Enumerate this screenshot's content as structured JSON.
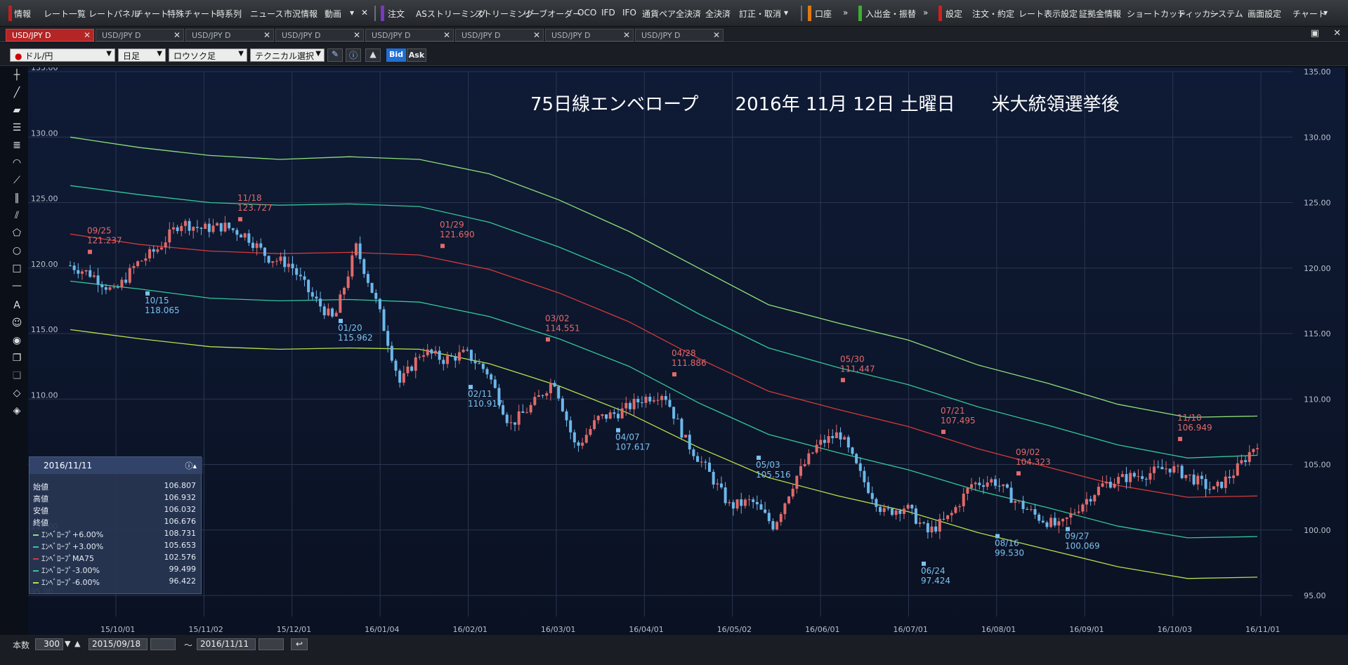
{
  "menu": {
    "items": [
      "情報",
      "レート一覧",
      "レートパネル",
      "チャート",
      "特殊チャート",
      "時系列",
      "ニュース",
      "市況情報",
      "動画",
      "注文",
      "ASストリーミング",
      "ストリーミング",
      "リーブオーダー",
      "OCO",
      "IFD",
      "IFO",
      "通貨ペア全決済",
      "全決済",
      "訂正・取消",
      "口座",
      "入出金・振替",
      "設定",
      "注文・約定",
      "レート表示設定",
      "証拠金情報",
      "ショートカット",
      "ティッカー",
      "システム",
      "画面設定",
      "チャート"
    ]
  },
  "tabs": [
    {
      "label": "USD/JPY D",
      "active": true
    },
    {
      "label": "USD/JPY D",
      "active": false
    },
    {
      "label": "USD/JPY D",
      "active": false
    },
    {
      "label": "USD/JPY D",
      "active": false
    },
    {
      "label": "USD/JPY D",
      "active": false
    },
    {
      "label": "USD/JPY D",
      "active": false
    },
    {
      "label": "USD/JPY D",
      "active": false
    },
    {
      "label": "USD/JPY D",
      "active": false
    }
  ],
  "toolbar": {
    "pair": "ドル/円",
    "period": "日足",
    "chart_type": "ロウソク足",
    "technical": "テクニカル選択",
    "bid": "Bid",
    "ask": "Ask"
  },
  "chart": {
    "title": "75日線エンベロープ　　2016年 11月 12日 土曜日　　米大統領選挙後",
    "y_ticks": [
      "135.00",
      "130.00",
      "125.00",
      "120.00",
      "115.00",
      "110.00",
      "105.00",
      "100.00",
      "95.00"
    ],
    "x_ticks": [
      "15/10/01",
      "15/11/02",
      "15/12/01",
      "16/01/04",
      "16/02/01",
      "16/03/01",
      "16/04/01",
      "16/05/02",
      "16/06/01",
      "16/07/01",
      "16/08/01",
      "16/09/01",
      "16/10/03",
      "16/11/01"
    ],
    "annotations": [
      {
        "date": "09/25",
        "value": "121.237",
        "kind": "high"
      },
      {
        "date": "10/15",
        "value": "118.065",
        "kind": "low"
      },
      {
        "date": "11/18",
        "value": "123.727",
        "kind": "high"
      },
      {
        "date": "01/20",
        "value": "115.962",
        "kind": "low"
      },
      {
        "date": "01/29",
        "value": "121.690",
        "kind": "high"
      },
      {
        "date": "02/11",
        "value": "110.917",
        "kind": "low"
      },
      {
        "date": "03/02",
        "value": "114.551",
        "kind": "high"
      },
      {
        "date": "04/07",
        "value": "107.617",
        "kind": "low"
      },
      {
        "date": "04/28",
        "value": "111.886",
        "kind": "high"
      },
      {
        "date": "05/03",
        "value": "105.516",
        "kind": "low"
      },
      {
        "date": "05/30",
        "value": "111.447",
        "kind": "high"
      },
      {
        "date": "06/24",
        "value": "97.424",
        "kind": "low"
      },
      {
        "date": "07/21",
        "value": "107.495",
        "kind": "high"
      },
      {
        "date": "08/16",
        "value": "99.530",
        "kind": "low"
      },
      {
        "date": "09/02",
        "value": "104.323",
        "kind": "high"
      },
      {
        "date": "09/27",
        "value": "100.069",
        "kind": "low"
      },
      {
        "date": "11/10",
        "value": "106.949",
        "kind": "high"
      }
    ]
  },
  "chart_data": {
    "type": "line",
    "ylim": [
      95,
      135
    ],
    "series": [
      {
        "name": "エンベロープ+6.00%",
        "color": "#8ee07a",
        "values": [
          130.0,
          129.2,
          128.6,
          128.3,
          128.5,
          128.3,
          127.2,
          125.2,
          122.8,
          120.0,
          117.2,
          115.8,
          114.5,
          112.6,
          111.2,
          109.6,
          108.6,
          108.7
        ]
      },
      {
        "name": "エンベロープ+3.00%",
        "color": "#33c79a",
        "values": [
          126.3,
          125.6,
          125.0,
          124.8,
          124.9,
          124.7,
          123.5,
          121.6,
          119.4,
          116.5,
          113.9,
          112.4,
          111.1,
          109.4,
          108.0,
          106.5,
          105.5,
          105.7
        ]
      },
      {
        "name": "エンベロープMA75",
        "color": "#d23a3a",
        "values": [
          122.6,
          121.8,
          121.3,
          121.1,
          121.2,
          121.0,
          119.9,
          118.1,
          115.9,
          113.1,
          110.6,
          109.2,
          107.9,
          106.2,
          104.8,
          103.4,
          102.5,
          102.6
        ]
      },
      {
        "name": "エンベロープ-3.00%",
        "color": "#33c79a",
        "values": [
          119.0,
          118.4,
          117.7,
          117.5,
          117.6,
          117.4,
          116.3,
          114.6,
          112.5,
          109.7,
          107.3,
          105.9,
          104.6,
          103.0,
          101.7,
          100.3,
          99.4,
          99.5
        ]
      },
      {
        "name": "エンベロープ-6.00%",
        "color": "#b7e04a",
        "values": [
          115.3,
          114.6,
          114.0,
          113.8,
          113.9,
          113.8,
          112.7,
          111.0,
          108.9,
          106.3,
          104.0,
          102.6,
          101.4,
          99.8,
          98.5,
          97.2,
          96.3,
          96.4
        ]
      }
    ],
    "price": [
      120.2,
      119.5,
      118.1,
      120.3,
      121.5,
      123.5,
      123.0,
      123.2,
      122.5,
      120.8,
      120.3,
      117.8,
      116.0,
      121.6,
      117.0,
      111.2,
      113.7,
      113.0,
      113.5,
      112.0,
      108.0,
      109.5,
      111.5,
      106.2,
      108.5,
      109.0,
      110.0,
      110.5,
      106.8,
      104.5,
      101.8,
      102.2,
      100.3,
      104.0,
      106.5,
      107.4,
      104.0,
      101.3,
      101.8,
      99.8,
      101.0,
      103.5,
      103.8,
      102.2,
      101.0,
      100.2,
      102.0,
      103.5,
      104.0,
      104.3,
      104.8,
      104.0,
      103.0,
      104.5,
      106.7
    ]
  },
  "info": {
    "date": "2016/11/11",
    "rows": [
      {
        "label": "始値",
        "value": "106.807"
      },
      {
        "label": "高値",
        "value": "106.932"
      },
      {
        "label": "安値",
        "value": "106.032"
      },
      {
        "label": "終値",
        "value": "106.676"
      },
      {
        "label": "ｴﾝﾍﾞﾛｰﾌﾟ+6.00%",
        "value": "108.731"
      },
      {
        "label": "ｴﾝﾍﾞﾛｰﾌﾟ+3.00%",
        "value": "105.653"
      },
      {
        "label": "ｴﾝﾍﾞﾛｰﾌﾟMA75",
        "value": "102.576"
      },
      {
        "label": "ｴﾝﾍﾞﾛｰﾌﾟ-3.00%",
        "value": "99.499"
      },
      {
        "label": "ｴﾝﾍﾞﾛｰﾌﾟ-6.00%",
        "value": "96.422"
      }
    ]
  },
  "bottom": {
    "count_label": "本数",
    "count": "300",
    "from": "2015/09/18",
    "tilde": "〜",
    "to": "2016/11/11"
  }
}
